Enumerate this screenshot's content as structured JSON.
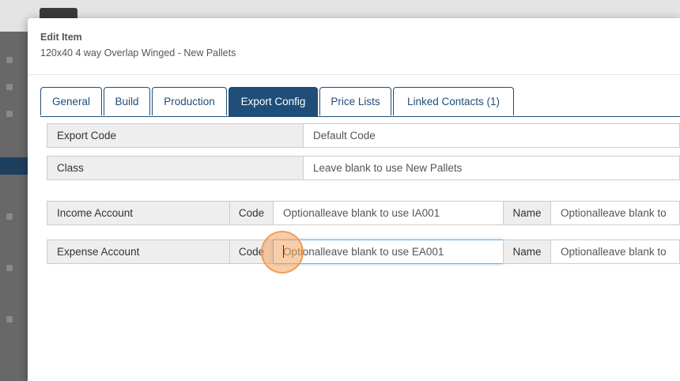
{
  "modal": {
    "title": "Edit Item",
    "subtitle": "120x40 4 way Overlap Winged - New Pallets"
  },
  "tabs": [
    {
      "label": "General",
      "active": false
    },
    {
      "label": "Build",
      "active": false
    },
    {
      "label": "Production",
      "active": false
    },
    {
      "label": "Export Config",
      "active": true
    },
    {
      "label": "Price Lists",
      "active": false
    },
    {
      "label": "Linked Contacts (1)",
      "active": false
    }
  ],
  "form": {
    "export_code": {
      "label": "Export Code",
      "placeholder": "Default Code"
    },
    "class": {
      "label": "Class",
      "placeholder": "Leave blank to use New Pallets"
    },
    "income_account": {
      "label": "Income Account",
      "code_label": "Code",
      "code_placeholder": "Optionalleave blank to use IA001",
      "name_label": "Name",
      "name_placeholder": "Optionalleave blank to use"
    },
    "expense_account": {
      "label": "Expense Account",
      "code_label": "Code",
      "code_placeholder": "Optionalleave blank to use EA001",
      "name_label": "Name",
      "name_placeholder": "Optionalleave blank to use"
    }
  },
  "colors": {
    "accent": "#1f4e79",
    "focus": "#66afe9",
    "click_indicator": "#f4a460"
  }
}
